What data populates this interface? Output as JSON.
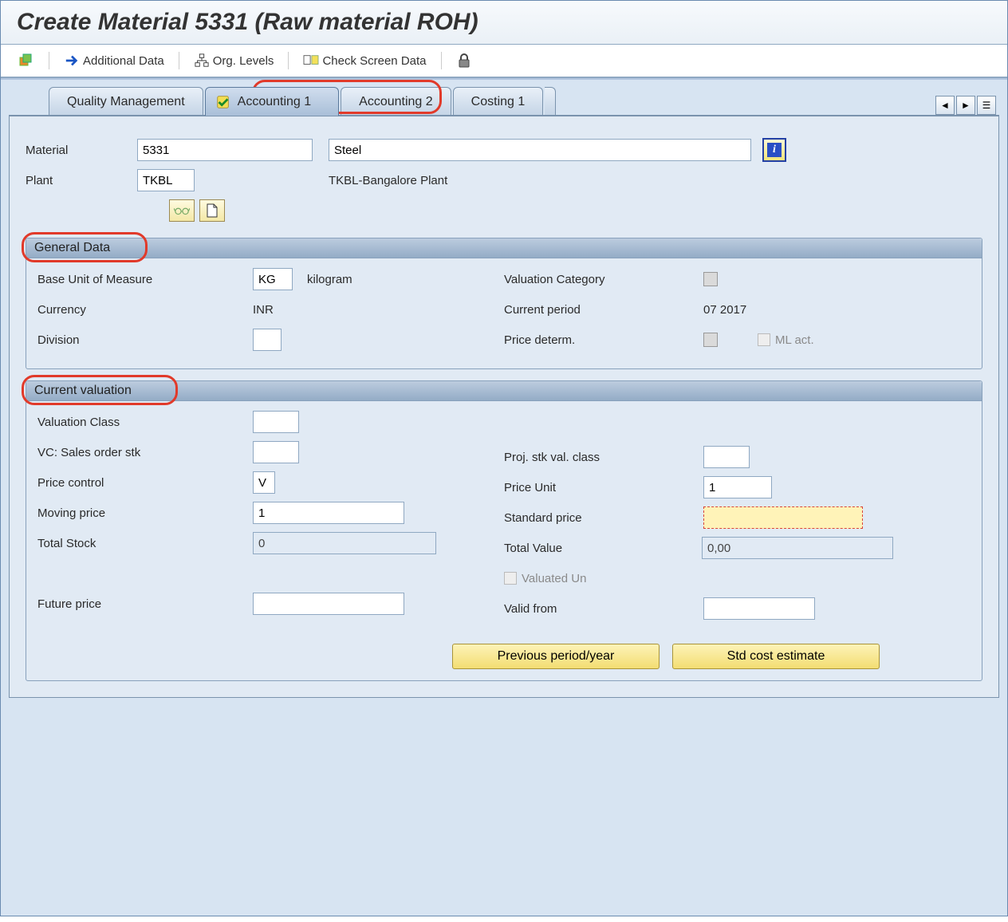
{
  "pageTitle": "Create Material 5331 (Raw material ROH)",
  "toolbar": {
    "additionalData": "Additional Data",
    "orgLevels": "Org. Levels",
    "checkScreenData": "Check Screen Data"
  },
  "tabs": {
    "qualityMgmt": "Quality Management",
    "accounting1": "Accounting 1",
    "accounting2": "Accounting 2",
    "costing1": "Costing 1"
  },
  "header": {
    "materialLabel": "Material",
    "materialId": "5331",
    "materialDesc": "Steel",
    "plantLabel": "Plant",
    "plantId": "TKBL",
    "plantDesc": "TKBL-Bangalore Plant"
  },
  "generalData": {
    "title": "General Data",
    "baseUomLabel": "Base Unit of Measure",
    "baseUom": "KG",
    "baseUomDesc": "kilogram",
    "currencyLabel": "Currency",
    "currency": "INR",
    "divisionLabel": "Division",
    "division": "",
    "valCategoryLabel": "Valuation Category",
    "valCategory": "",
    "currentPeriodLabel": "Current period",
    "currentPeriod": "07 2017",
    "priceDetermLabel": "Price determ.",
    "mlActLabel": "ML act."
  },
  "currentValuation": {
    "title": "Current valuation",
    "valuationClassLabel": "Valuation Class",
    "valuationClass": "",
    "vcSalesOrderLabel": "VC: Sales order stk",
    "vcSalesOrder": "",
    "projStkValClassLabel": "Proj. stk val. class",
    "projStkValClass": "",
    "priceControlLabel": "Price control",
    "priceControl": "V",
    "priceUnitLabel": "Price Unit",
    "priceUnit": "1",
    "movingPriceLabel": "Moving price",
    "movingPrice": "1",
    "standardPriceLabel": "Standard price",
    "standardPrice": "",
    "totalStockLabel": "Total Stock",
    "totalStock": "0",
    "totalValueLabel": "Total Value",
    "totalValue": "0,00",
    "valuatedUnLabel": "Valuated Un",
    "futurePriceLabel": "Future price",
    "futurePrice": "",
    "validFromLabel": "Valid from",
    "validFrom": "",
    "prevPeriodBtn": "Previous period/year",
    "stdCostBtn": "Std cost estimate"
  }
}
